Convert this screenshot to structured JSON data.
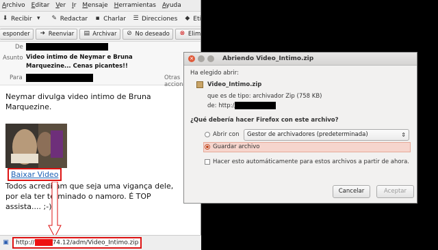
{
  "mail": {
    "menu": [
      "Archivo",
      "Editar",
      "Ver",
      "Ir",
      "Mensaje",
      "Herramientas",
      "Ayuda"
    ],
    "toolbar": {
      "receive": "Recibir",
      "write": "Redactar",
      "chat": "Charlar",
      "addresses": "Direcciones",
      "tag": "Etiq"
    },
    "header_buttons": {
      "reply": "esponder",
      "forward": "Reenviar",
      "archive": "Archivar",
      "junk": "No deseado",
      "delete": "Eliminar"
    },
    "headers": {
      "from_label": "De",
      "subject_label": "Asunto",
      "subject": "Video intimo de Neymar e Bruna Marquezine... Cenas picantes!!",
      "to_label": "Para",
      "other_actions": "Otras acciones"
    },
    "body": {
      "intro": "Neymar divulga video intimo de Bruna Marquezine.",
      "link": "Baixar Video",
      "text": "Todos acreditam que seja uma vigança dele, por ela ter terminado o namoro. É TOP assista.... ;-)"
    },
    "status_url": "http://",
    "status_url_tail": "74.12/adm/Video_Intimo.zip"
  },
  "dialog": {
    "title": "Abriendo Video_Intimo.zip",
    "chosen_label": "Ha elegido abrir:",
    "file_name": "Video_Intimo.zip",
    "file_type": "que es de tipo:  archivador Zip (758 KB)",
    "from_label": "de: http://",
    "question": "¿Qué debería hacer Firefox con este archivo?",
    "open_with_label": "Abrir con",
    "open_with_value": "Gestor de archivadores (predeterminada)",
    "save_label": "Guardar archivo",
    "auto_label": "Hacer esto automáticamente para estos archivos a partir de ahora.",
    "cancel": "Cancelar",
    "accept": "Aceptar"
  },
  "colors": {
    "highlight_red": "#d11111",
    "link_blue": "#1a5fb4",
    "save_highlight": "#f6d5cd"
  }
}
